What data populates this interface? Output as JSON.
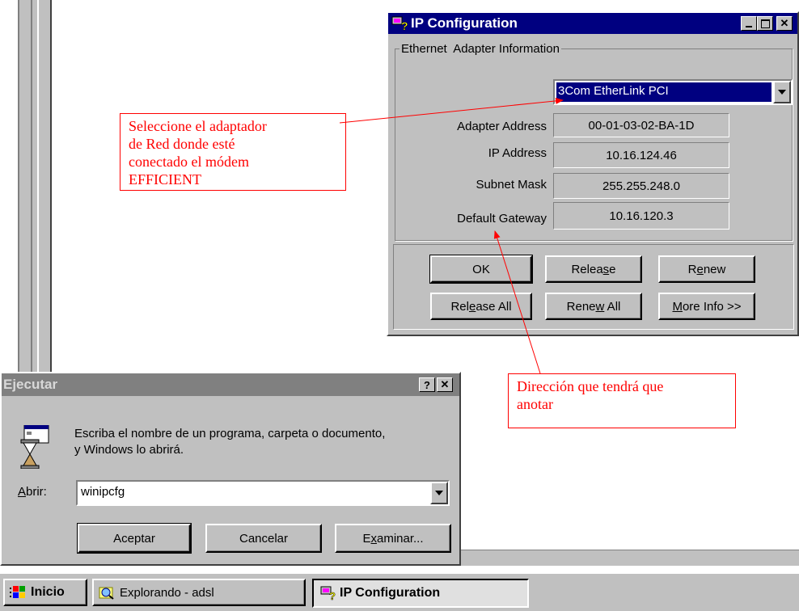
{
  "ip_config": {
    "title": "IP Configuration",
    "group_label": "Ethernet  Adapter Information",
    "adapter_selected": "3Com EtherLink PCI",
    "rows": [
      {
        "label": "Adapter Address",
        "value": "00-01-03-02-BA-1D"
      },
      {
        "label": "IP Address",
        "value": "10.16.124.46"
      },
      {
        "label": "Subnet Mask",
        "value": "255.255.248.0"
      },
      {
        "label": "Default Gateway",
        "value": "10.16.120.3"
      }
    ],
    "buttons": {
      "ok": "OK",
      "release_a": "Relea",
      "release_u": "s",
      "release_b": "e",
      "renew_a": "R",
      "renew_u": "e",
      "renew_b": "new",
      "release_all_a": "Rel",
      "release_all_u": "e",
      "release_all_b": "ase All",
      "renew_all_a": "Rene",
      "renew_all_u": "w",
      "renew_all_b": " All",
      "more_info_u": "M",
      "more_info_b": "ore Info >>"
    }
  },
  "run": {
    "title": "Ejecutar",
    "message_line1": "Escriba el nombre de un programa, carpeta o documento,",
    "message_line2": "y Windows lo abrirá.",
    "open_label_u": "A",
    "open_label_b": "brir:",
    "open_value": "winipcfg",
    "accept": "Aceptar",
    "cancel": "Cancelar",
    "browse_a": "E",
    "browse_u": "x",
    "browse_b": "aminar..."
  },
  "annotations": {
    "note1_line1": "Seleccione el adaptador",
    "note1_line2": "de Red donde esté",
    "note1_line3": "conectado el módem",
    "note1_line4": "EFFICIENT",
    "note2_line1": "Dirección que tendrá que",
    "note2_line2": "anotar",
    "color": "#ff0000"
  },
  "taskbar": {
    "start": "Inicio",
    "task1": "Explorando - adsl",
    "task2": "IP Configuration"
  }
}
